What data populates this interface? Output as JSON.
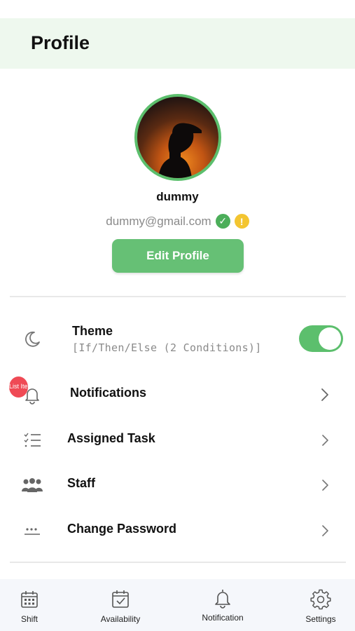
{
  "header": {
    "title": "Profile"
  },
  "profile": {
    "name": "dummy",
    "email": "dummy@gmail.com",
    "verified_mark": "✓",
    "warning_mark": "!",
    "edit_label": "Edit Profile",
    "avatar_icon": "silhouette-sunset-photo"
  },
  "settings": {
    "theme": {
      "label": "Theme",
      "subtitle": "[If/Then/Else (2 Conditions)]",
      "toggle_on": true,
      "icon": "moon-icon"
    },
    "items": [
      {
        "label": "Notifications",
        "icon": "bell-icon"
      },
      {
        "label": "Assigned Task",
        "icon": "checklist-icon"
      },
      {
        "label": "Staff",
        "icon": "people-icon"
      },
      {
        "label": "Change Password",
        "icon": "password-dots-icon"
      }
    ],
    "list_badge": "List Item"
  },
  "bottom_nav": {
    "items": [
      {
        "label": "Shift",
        "icon": "calendar-grid-icon"
      },
      {
        "label": "Availability",
        "icon": "calendar-check-icon"
      },
      {
        "label": "Notification",
        "icon": "bell-icon"
      },
      {
        "label": "Settings",
        "icon": "gear-icon"
      }
    ]
  },
  "colors": {
    "accent": "#5cbf6d",
    "header_bg": "#eef8ee",
    "warning": "#f3c531",
    "badge_red": "#ef4a55",
    "nav_bg": "#f5f7fb"
  }
}
